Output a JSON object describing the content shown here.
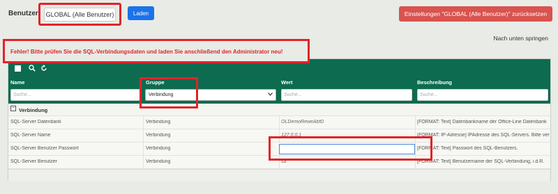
{
  "toolbar": {
    "user_label": "Benutzer:",
    "user_select_value": "GLOBAL (Alle Benutzer)",
    "load_label": "Laden",
    "reset_label": "Einstellungen \"GLOBAL (Alle Benutzer)\" zurücksetzen",
    "jump_label": "Nach unten springen"
  },
  "error": {
    "message": "Fehler! Bitte prüfen Sie die SQL-Verbindungsdaten und laden Sie anschließend den Administrator neu!"
  },
  "grid": {
    "icons": [
      "new-icon",
      "search-icon",
      "refresh-icon"
    ],
    "columns": [
      {
        "title": "Name",
        "filter_placeholder": "Suche..."
      },
      {
        "title": "Gruppe",
        "filter_value": "Verbindung"
      },
      {
        "title": "Wert",
        "filter_placeholder": "Suche..."
      },
      {
        "title": "Beschreibung",
        "filter_placeholder": "Suche..."
      }
    ],
    "group": {
      "toggle": "−",
      "label": "Verbindung"
    },
    "rows": [
      {
        "name": "SQL-Server Datenbank",
        "gruppe": "Verbindung",
        "wert": "OLDemoReweAbfD",
        "beschreibung": "[FORMAT: Text] Datenbankname der Office-Line Datenbank"
      },
      {
        "name": "SQL-Server Name",
        "gruppe": "Verbindung",
        "wert": "127.0.0.1",
        "beschreibung": "[FORMAT: IP-Adresse] IPAdresse des SQL-Servers. Bitte verwenden"
      },
      {
        "name": "SQL-Server Benutzer Passwort",
        "gruppe": "Verbindung",
        "wert": "",
        "beschreibung": "[FORMAT: Text] Passwort des SQL-Benutzers."
      },
      {
        "name": "SQL-Server Benutzer",
        "gruppe": "Verbindung",
        "wert": "sa",
        "beschreibung": "[FORMAT: Text] Benutzername der SQL-Verbindung, i.d.R."
      }
    ]
  },
  "colors": {
    "header_green": "#0d6b4f",
    "load_button": "#1a73e8",
    "reset_button": "#d9534f",
    "highlight_red": "#e0242a"
  }
}
